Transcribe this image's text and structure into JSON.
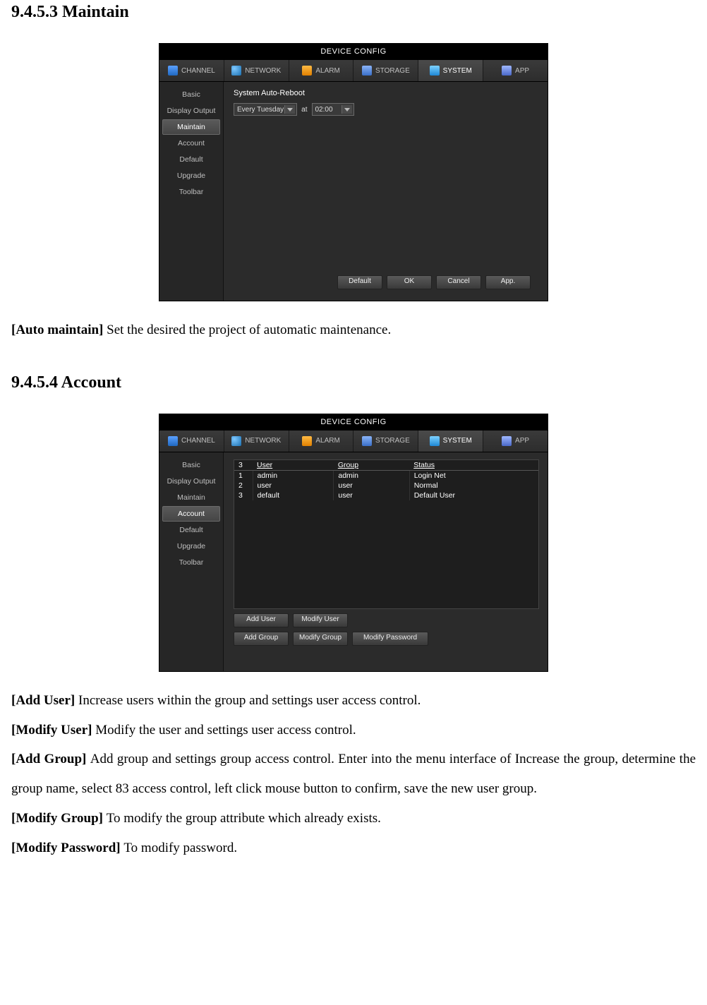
{
  "headings": {
    "maintain": "9.4.5.3 Maintain",
    "account": "9.4.5.4 Account"
  },
  "window": {
    "title": "DEVICE CONFIG",
    "tabs": {
      "channel": "CHANNEL",
      "network": "NETWORK",
      "alarm": "ALARM",
      "storage": "STORAGE",
      "system": "SYSTEM",
      "app": "APP"
    },
    "sidebar": {
      "basic": "Basic",
      "display_output": "Display Output",
      "maintain": "Maintain",
      "account": "Account",
      "default": "Default",
      "upgrade": "Upgrade",
      "toolbar": "Toolbar"
    },
    "footer": {
      "default": "Default",
      "ok": "OK",
      "cancel": "Cancel",
      "app": "App."
    }
  },
  "maintain_panel": {
    "label": "System Auto-Reboot",
    "day": "Every Tuesday",
    "at": "at",
    "time": "02:00"
  },
  "account_panel": {
    "count": "3",
    "headers": {
      "user": "User",
      "group": "Group",
      "status": "Status"
    },
    "rows": [
      {
        "idx": "1",
        "user": "admin",
        "group": "admin",
        "status": "Login Net"
      },
      {
        "idx": "2",
        "user": "user",
        "group": "user",
        "status": "Normal"
      },
      {
        "idx": "3",
        "user": "default",
        "group": "user",
        "status": "Default User"
      }
    ],
    "buttons": {
      "add_user": "Add User",
      "modify_user": "Modify User",
      "add_group": "Add Group",
      "modify_group": "Modify Group",
      "modify_password": "Modify Password"
    }
  },
  "descriptions": {
    "auto_maintain": {
      "label": "[Auto maintain] ",
      "text": "Set the desired the project of automatic maintenance."
    },
    "add_user": {
      "label": "[Add User] ",
      "text": "Increase users within the group and settings user access control."
    },
    "modify_user": {
      "label": "[Modify User] ",
      "text": "Modify the user and settings user access control."
    },
    "add_group": {
      "label": "[Add Group] ",
      "text": "Add group and settings group access control. Enter into the menu interface of Increase the group, determine the group name, select 83 access control, left click mouse button to confirm, save the new user group."
    },
    "modify_group": {
      "label": "[Modify Group] ",
      "text": "To modify the group attribute which already exists."
    },
    "modify_password": {
      "label": "[Modify Password] ",
      "text": "To modify password."
    }
  }
}
